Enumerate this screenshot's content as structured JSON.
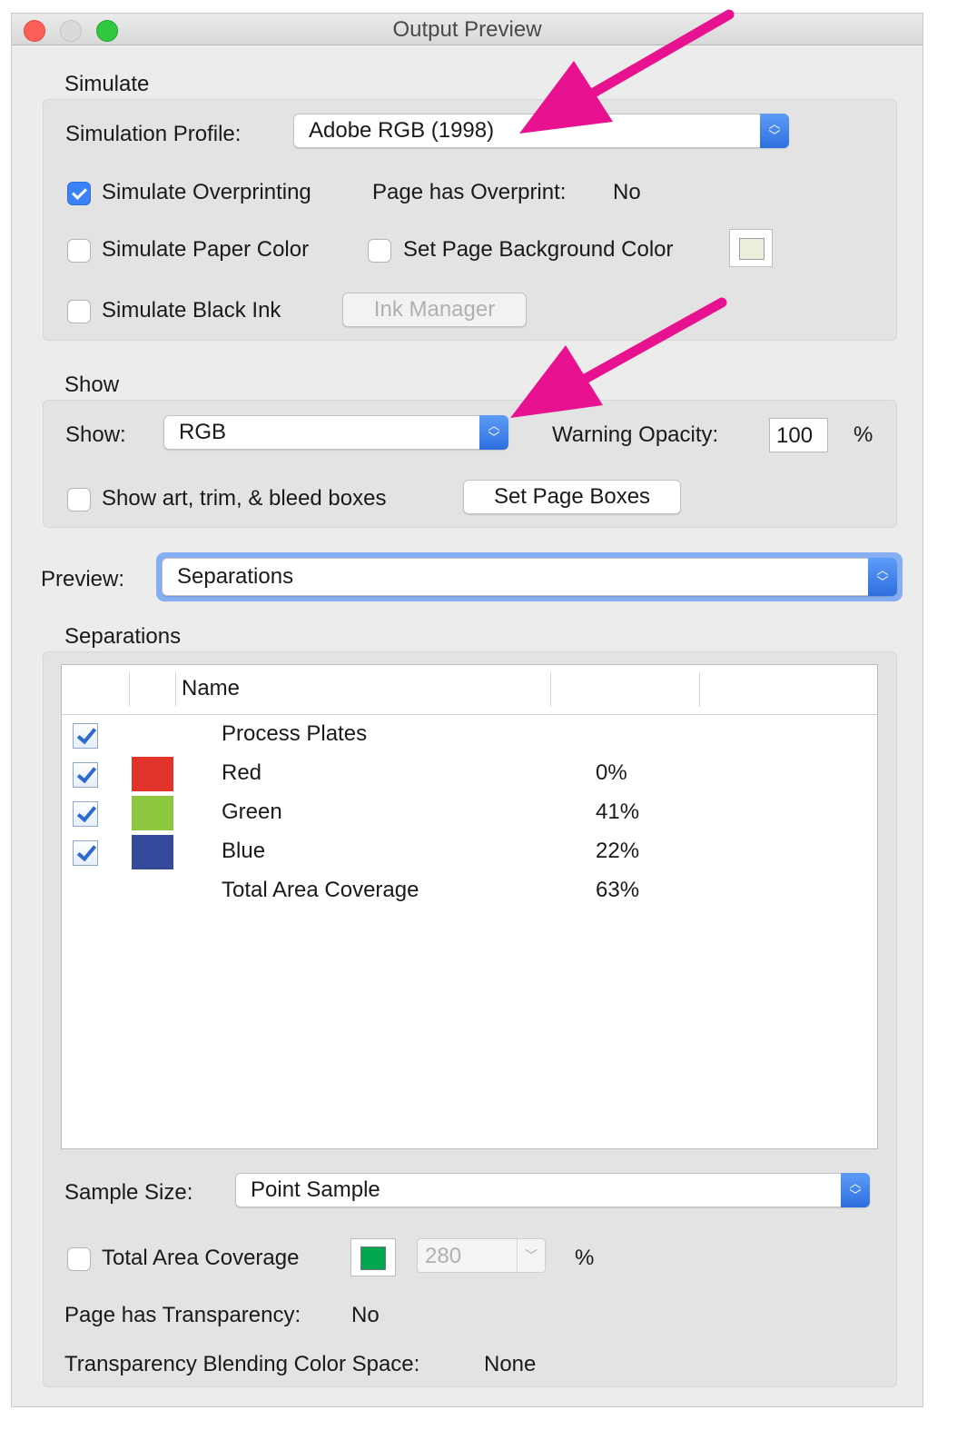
{
  "window": {
    "title": "Output Preview"
  },
  "simulate": {
    "section_label": "Simulate",
    "profile_label": "Simulation Profile:",
    "profile_value": "Adobe RGB (1998)",
    "overprint_label": "Simulate Overprinting",
    "overprint_checked": true,
    "page_overprint_label": "Page has Overprint:",
    "page_overprint_value": "No",
    "paper_color_label": "Simulate Paper Color",
    "bg_color_label": "Set Page Background Color",
    "bg_swatch_color": "#eeeedd",
    "black_ink_label": "Simulate Black Ink",
    "ink_manager_label": "Ink Manager"
  },
  "show": {
    "section_label": "Show",
    "show_label": "Show:",
    "show_value": "RGB",
    "warning_label": "Warning Opacity:",
    "warning_value": "100",
    "warning_unit": "%",
    "boxes_label": "Show art, trim, & bleed boxes",
    "set_boxes_label": "Set Page Boxes"
  },
  "preview": {
    "label": "Preview:",
    "value": "Separations"
  },
  "separations": {
    "section_label": "Separations",
    "header_name": "Name",
    "process_plates": "Process Plates",
    "rows": [
      {
        "name": "Red",
        "pct": "0%",
        "color": "#e2332b"
      },
      {
        "name": "Green",
        "pct": "41%",
        "color": "#8dc63f"
      },
      {
        "name": "Blue",
        "pct": "22%",
        "color": "#354a9b"
      }
    ],
    "total_name": "Total Area Coverage",
    "total_pct": "63%"
  },
  "bottom": {
    "sample_label": "Sample Size:",
    "sample_value": "Point Sample",
    "tac_label": "Total Area Coverage",
    "tac_swatch_color": "#00a650",
    "tac_value": "280",
    "tac_unit": "%",
    "transparency_label": "Page has Transparency:",
    "transparency_value": "No",
    "blend_label": "Transparency Blending Color Space:",
    "blend_value": "None"
  },
  "annotation": {
    "arrow_color": "#e8118f"
  }
}
